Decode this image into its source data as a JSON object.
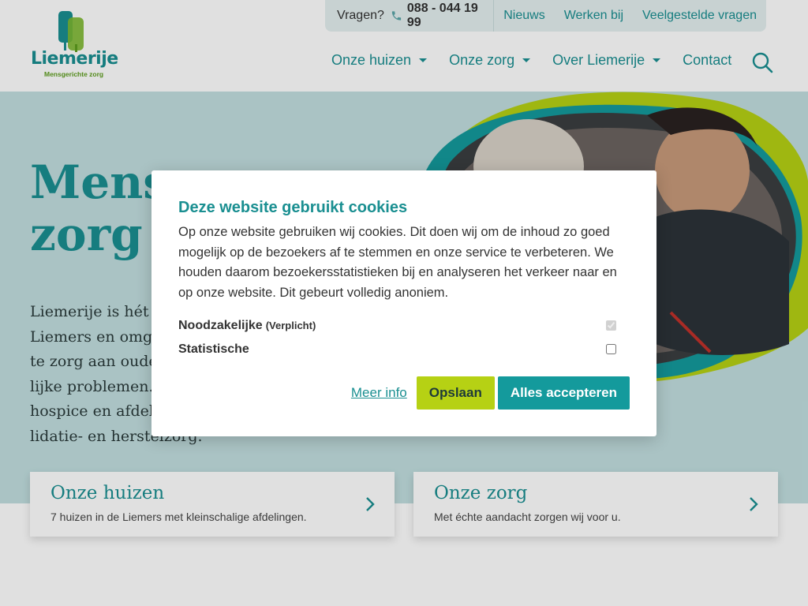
{
  "logo": {
    "name": "Liemerije",
    "tagline": "Mensgerichte zorg"
  },
  "topbar": {
    "question_label": "Vragen?",
    "phone": "088 - 044 19 99",
    "links": [
      "Nieuws",
      "Werken bij",
      "Veelgestelde vragen"
    ]
  },
  "nav": {
    "items": [
      {
        "label": "Onze huizen",
        "has_dropdown": true
      },
      {
        "label": "Onze zorg",
        "has_dropdown": true
      },
      {
        "label": "Over Liemerije",
        "has_dropdown": true
      },
      {
        "label": "Contact",
        "has_dropdown": false
      }
    ],
    "search_icon": "search-icon"
  },
  "hero": {
    "title_line1": "Mensg",
    "title_line2": "zorg",
    "text_lines": [
      "Liemerije is hét a",
      "Liemers en omge",
      "te zorg aan ouder",
      "lijke problemen. I",
      "hospice en afdeli",
      "lidatie- en herstelzorg."
    ]
  },
  "cards": [
    {
      "title": "Onze huizen",
      "subtitle": "7 huizen in de Liemers met kleinschalige afdelingen."
    },
    {
      "title": "Onze zorg",
      "subtitle": "Met échte aandacht zorgen wij voor u."
    }
  ],
  "cookie_modal": {
    "title": "Deze website gebruikt cookies",
    "body": "Op onze website gebruiken wij cookies. Dit doen wij om de inhoud zo goed mogelijk op de bezoekers af te stemmen en onze service te verbeteren. We houden daarom bezoekersstatistieken bij en analyseren het verkeer naar en op onze website. Dit gebeurt volledig anoniem.",
    "options": [
      {
        "label": "Noodzakelijke",
        "note": "(Verplicht)",
        "checked": true,
        "disabled": true
      },
      {
        "label": "Statistische",
        "note": "",
        "checked": false,
        "disabled": false
      }
    ],
    "more_info": "Meer info",
    "save": "Opslaan",
    "accept_all": "Alles accepteren"
  },
  "colors": {
    "brand_teal": "#1a8f91",
    "brand_green": "#b6d114",
    "hero_bg": "#c2dfe0"
  }
}
